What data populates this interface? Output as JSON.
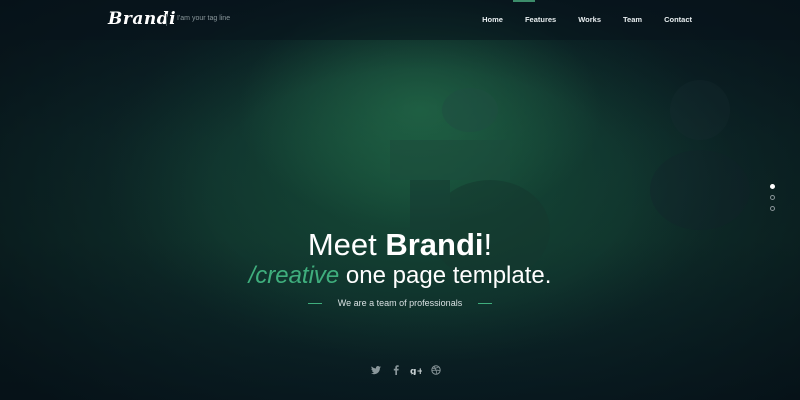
{
  "header": {
    "logo": "Brandi",
    "tagline": "I'am your tag line",
    "nav": [
      "Home",
      "Features",
      "Works",
      "Team",
      "Contact"
    ]
  },
  "hero": {
    "headline_prefix": "Meet ",
    "headline_brand": "Brandi",
    "headline_suffix": "!",
    "subheadline_accent": "/creative",
    "subheadline_rest": " one page template.",
    "tagline": "We are a team of professionals"
  },
  "social": [
    "twitter-icon",
    "facebook-icon",
    "google-plus-icon",
    "dribbble-icon"
  ],
  "slider": {
    "count": 3,
    "active": 1
  },
  "colors": {
    "accent": "#3fae7d",
    "background": "#0b1f22"
  }
}
